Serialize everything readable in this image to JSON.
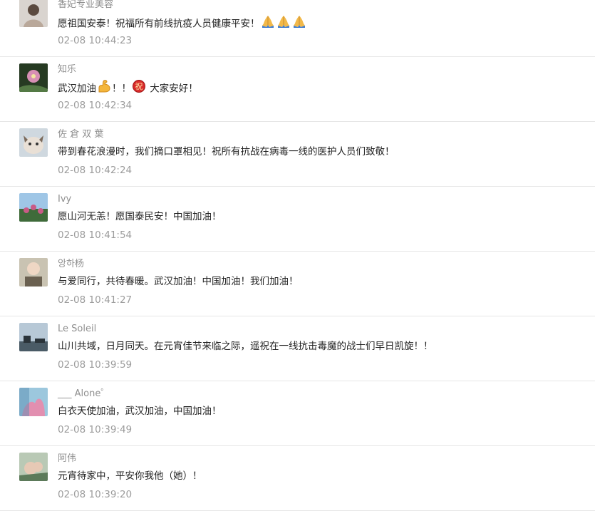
{
  "comments": [
    {
      "name": "香妃专业美容",
      "text_before": "愿祖国安泰！祝福所有前线抗疫人员健康平安！",
      "emojis_1": [
        "folded-hands-icon",
        "folded-hands-icon",
        "folded-hands-icon"
      ],
      "text_middle": "",
      "emojis_2": [],
      "text_after": "",
      "time": "02-08 10:44:23",
      "avatar_colors": [
        "#d9d4cf",
        "#5b4a3f",
        "#b9a89a"
      ]
    },
    {
      "name": "知乐",
      "text_before": "武汉加油",
      "emojis_1": [
        "flexed-biceps-icon"
      ],
      "text_middle": "！！",
      "emojis_2": [
        "blessing-badge-icon"
      ],
      "text_after": " 大家安好！",
      "time": "02-08 10:42:34",
      "avatar_colors": [
        "#263a22",
        "#d78fb4",
        "#547a45"
      ]
    },
    {
      "name": "佐 倉 双 葉",
      "text_before": "带到春花浪漫时，我们摘口罩相见！祝所有抗战在病毒一线的医护人员们致敬！",
      "emojis_1": [],
      "text_middle": "",
      "emojis_2": [],
      "text_after": "",
      "time": "02-08 10:42:24",
      "avatar_colors": [
        "#cfd8df",
        "#e9e0d6",
        "#7b6a5b"
      ]
    },
    {
      "name": "Ivy",
      "text_before": "愿山河无恙！愿国泰民安！中国加油！",
      "emojis_1": [],
      "text_middle": "",
      "emojis_2": [],
      "text_after": "",
      "time": "02-08 10:41:54",
      "avatar_colors": [
        "#9fc6e6",
        "#c95b86",
        "#3f6b3a"
      ]
    },
    {
      "name": "앙하杨",
      "text_before": "与爱同行，共待春暖。武汉加油！中国加油！我们加油！",
      "emojis_1": [],
      "text_middle": "",
      "emojis_2": [],
      "text_after": "",
      "time": "02-08 10:41:27",
      "avatar_colors": [
        "#c9c3b2",
        "#efd7c4",
        "#6a6050"
      ]
    },
    {
      "name": "Le Soleil",
      "text_before": "山川共域，日月同天。在元宵佳节来临之际，遥祝在一线抗击毒魔的战士们早日凯旋！！",
      "emojis_1": [],
      "text_middle": "",
      "emojis_2": [],
      "text_after": "",
      "time": "02-08 10:39:59",
      "avatar_colors": [
        "#b7c8d6",
        "#4a5b66",
        "#2a3339"
      ]
    },
    {
      "name": "___ Alone゜",
      "text_before": "白衣天使加油，武汉加油，中国加油！",
      "emojis_1": [],
      "text_middle": "",
      "emojis_2": [],
      "text_after": "",
      "time": "02-08 10:39:49",
      "avatar_colors": [
        "#9cc7dd",
        "#e28fb0",
        "#5a8fb4"
      ]
    },
    {
      "name": "阿伟",
      "text_before": "元宵待家中，平安你我他（她）！",
      "emojis_1": [],
      "text_middle": "",
      "emojis_2": [],
      "text_after": "",
      "time": "02-08 10:39:20",
      "avatar_colors": [
        "#b9c9b5",
        "#e6c9b5",
        "#5c7a5a"
      ]
    }
  ]
}
